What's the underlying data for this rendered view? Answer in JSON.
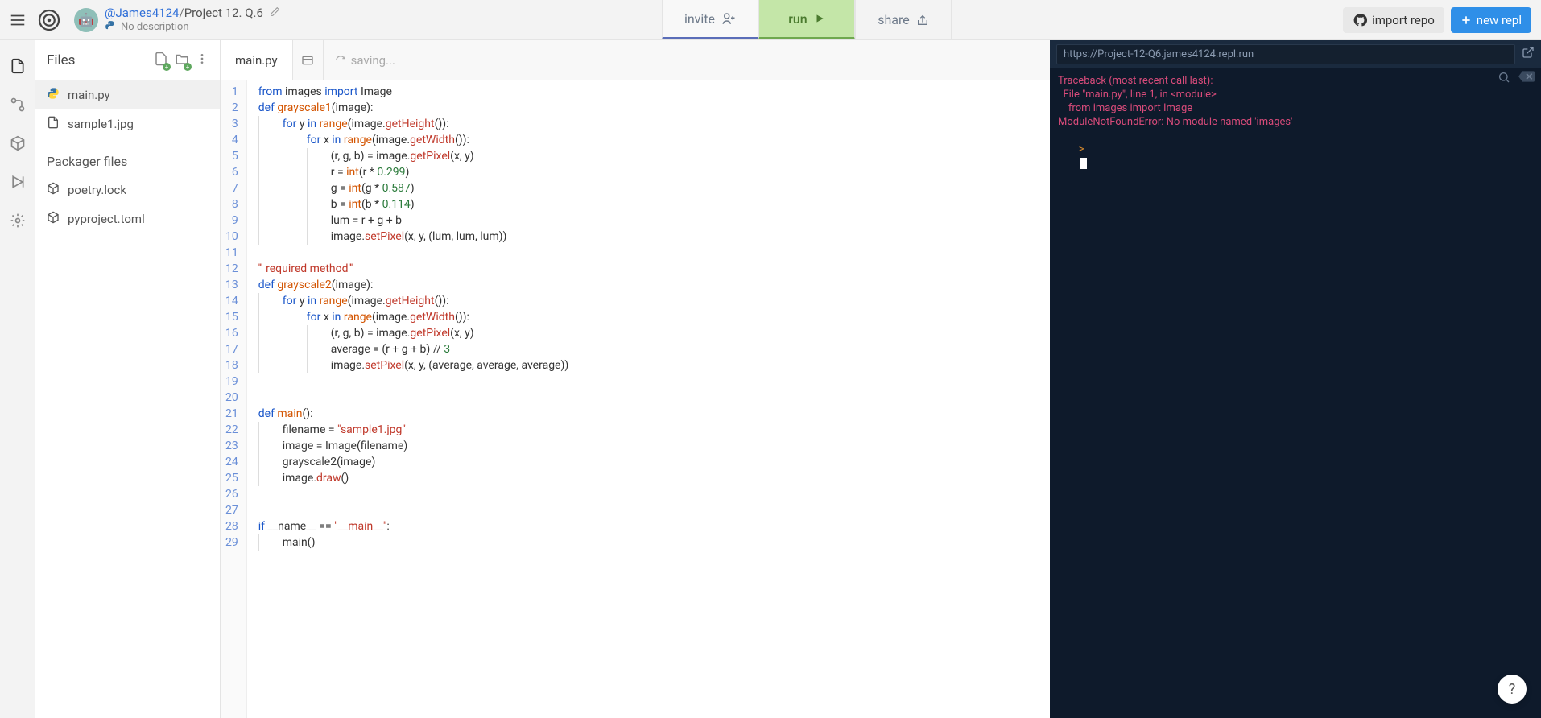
{
  "header": {
    "username": "@James4124",
    "slash": "/",
    "project": "Project 12. Q.6",
    "desc_prefix_icon": "🐍",
    "description": "No description",
    "invite": "invite",
    "run": "run",
    "share": "share",
    "import_repo": "import repo",
    "new_repl": "new repl"
  },
  "files": {
    "title": "Files",
    "items": [
      {
        "name": "main.py",
        "icon": "python"
      },
      {
        "name": "sample1.jpg",
        "icon": "file"
      }
    ],
    "packager_title": "Packager files",
    "packager_items": [
      {
        "name": "poetry.lock",
        "icon": "box"
      },
      {
        "name": "pyproject.toml",
        "icon": "box"
      }
    ]
  },
  "editor": {
    "tab": "main.py",
    "saving": "saving...",
    "lines": [
      [
        {
          "t": "kw",
          "v": "from"
        },
        {
          "t": "txt",
          "v": " images "
        },
        {
          "t": "kw",
          "v": "import"
        },
        {
          "t": "txt",
          "v": " Image"
        }
      ],
      [
        {
          "t": "kw",
          "v": "def"
        },
        {
          "t": "txt",
          "v": " "
        },
        {
          "t": "sp",
          "v": "grayscale1"
        },
        {
          "t": "txt",
          "v": "(image):"
        }
      ],
      [
        {
          "t": "ind",
          "n": 1
        },
        {
          "t": "kw",
          "v": "for"
        },
        {
          "t": "txt",
          "v": " y "
        },
        {
          "t": "kw",
          "v": "in"
        },
        {
          "t": "txt",
          "v": " "
        },
        {
          "t": "sp",
          "v": "range"
        },
        {
          "t": "txt",
          "v": "(image."
        },
        {
          "t": "fn",
          "v": "getHeight"
        },
        {
          "t": "txt",
          "v": "()):"
        }
      ],
      [
        {
          "t": "ind",
          "n": 2
        },
        {
          "t": "kw",
          "v": "for"
        },
        {
          "t": "txt",
          "v": " x "
        },
        {
          "t": "kw",
          "v": "in"
        },
        {
          "t": "txt",
          "v": " "
        },
        {
          "t": "sp",
          "v": "range"
        },
        {
          "t": "txt",
          "v": "(image."
        },
        {
          "t": "fn",
          "v": "getWidth"
        },
        {
          "t": "txt",
          "v": "()):"
        }
      ],
      [
        {
          "t": "ind",
          "n": 3
        },
        {
          "t": "txt",
          "v": "(r, g, b) = image."
        },
        {
          "t": "fn",
          "v": "getPixel"
        },
        {
          "t": "txt",
          "v": "(x, y)"
        }
      ],
      [
        {
          "t": "ind",
          "n": 3
        },
        {
          "t": "txt",
          "v": "r = "
        },
        {
          "t": "sp",
          "v": "int"
        },
        {
          "t": "txt",
          "v": "(r * "
        },
        {
          "t": "num",
          "v": "0.299"
        },
        {
          "t": "txt",
          "v": ")"
        }
      ],
      [
        {
          "t": "ind",
          "n": 3
        },
        {
          "t": "txt",
          "v": "g = "
        },
        {
          "t": "sp",
          "v": "int"
        },
        {
          "t": "txt",
          "v": "(g * "
        },
        {
          "t": "num",
          "v": "0.587"
        },
        {
          "t": "txt",
          "v": ")"
        }
      ],
      [
        {
          "t": "ind",
          "n": 3
        },
        {
          "t": "txt",
          "v": "b = "
        },
        {
          "t": "sp",
          "v": "int"
        },
        {
          "t": "txt",
          "v": "(b * "
        },
        {
          "t": "num",
          "v": "0.114"
        },
        {
          "t": "txt",
          "v": ")"
        }
      ],
      [
        {
          "t": "ind",
          "n": 3
        },
        {
          "t": "txt",
          "v": "lum = r + g + b"
        }
      ],
      [
        {
          "t": "ind",
          "n": 3
        },
        {
          "t": "txt",
          "v": "image."
        },
        {
          "t": "fn",
          "v": "setPixel"
        },
        {
          "t": "txt",
          "v": "(x, y, (lum, lum, lum))"
        }
      ],
      [],
      [
        {
          "t": "doc",
          "v": "''' required method'''"
        }
      ],
      [
        {
          "t": "kw",
          "v": "def"
        },
        {
          "t": "txt",
          "v": " "
        },
        {
          "t": "sp",
          "v": "grayscale2"
        },
        {
          "t": "txt",
          "v": "(image):"
        }
      ],
      [
        {
          "t": "ind",
          "n": 1
        },
        {
          "t": "kw",
          "v": "for"
        },
        {
          "t": "txt",
          "v": " y "
        },
        {
          "t": "kw",
          "v": "in"
        },
        {
          "t": "txt",
          "v": " "
        },
        {
          "t": "sp",
          "v": "range"
        },
        {
          "t": "txt",
          "v": "(image."
        },
        {
          "t": "fn",
          "v": "getHeight"
        },
        {
          "t": "txt",
          "v": "()):"
        }
      ],
      [
        {
          "t": "ind",
          "n": 2
        },
        {
          "t": "kw",
          "v": "for"
        },
        {
          "t": "txt",
          "v": " x "
        },
        {
          "t": "kw",
          "v": "in"
        },
        {
          "t": "txt",
          "v": " "
        },
        {
          "t": "sp",
          "v": "range"
        },
        {
          "t": "txt",
          "v": "(image."
        },
        {
          "t": "fn",
          "v": "getWidth"
        },
        {
          "t": "txt",
          "v": "()):"
        }
      ],
      [
        {
          "t": "ind",
          "n": 3
        },
        {
          "t": "txt",
          "v": "(r, g, b) = image."
        },
        {
          "t": "fn",
          "v": "getPixel"
        },
        {
          "t": "txt",
          "v": "(x, y)"
        }
      ],
      [
        {
          "t": "ind",
          "n": 3
        },
        {
          "t": "txt",
          "v": "average = (r + g + b) // "
        },
        {
          "t": "num",
          "v": "3"
        }
      ],
      [
        {
          "t": "ind",
          "n": 3
        },
        {
          "t": "txt",
          "v": "image."
        },
        {
          "t": "fn",
          "v": "setPixel"
        },
        {
          "t": "txt",
          "v": "(x, y, (average, average, average))"
        }
      ],
      [],
      [],
      [
        {
          "t": "kw",
          "v": "def"
        },
        {
          "t": "txt",
          "v": " "
        },
        {
          "t": "sp",
          "v": "main"
        },
        {
          "t": "txt",
          "v": "():"
        }
      ],
      [
        {
          "t": "ind",
          "n": 1
        },
        {
          "t": "txt",
          "v": "filename = "
        },
        {
          "t": "str",
          "v": "\"sample1.jpg\""
        }
      ],
      [
        {
          "t": "ind",
          "n": 1
        },
        {
          "t": "txt",
          "v": "image = Image(filename)"
        }
      ],
      [
        {
          "t": "ind",
          "n": 1
        },
        {
          "t": "txt",
          "v": "grayscale2(image)"
        }
      ],
      [
        {
          "t": "ind",
          "n": 1
        },
        {
          "t": "txt",
          "v": "image."
        },
        {
          "t": "fn",
          "v": "draw"
        },
        {
          "t": "txt",
          "v": "()"
        }
      ],
      [],
      [],
      [
        {
          "t": "kw",
          "v": "if"
        },
        {
          "t": "txt",
          "v": " __name__ == "
        },
        {
          "t": "str",
          "v": "\"__main__\""
        },
        {
          "t": "txt",
          "v": ":"
        }
      ],
      [
        {
          "t": "ind",
          "n": 1
        },
        {
          "t": "txt",
          "v": "main()"
        }
      ]
    ]
  },
  "terminal": {
    "url": "https://Project-12-Q6.james4124.repl.run",
    "output": [
      "Traceback (most recent call last):",
      "  File \"main.py\", line 1, in <module>",
      "    from images import Image",
      "ModuleNotFoundError: No module named 'images'"
    ],
    "prompt": ">"
  },
  "help": "?"
}
